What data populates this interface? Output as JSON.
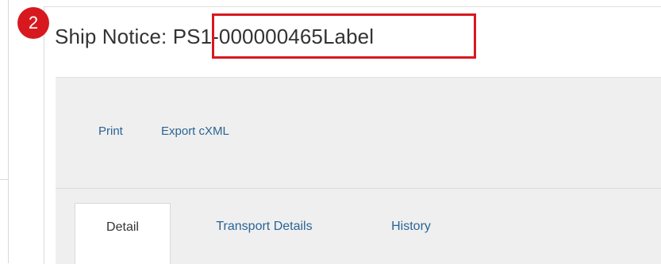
{
  "header": {
    "title_prefix": "Ship Notice: ",
    "title_id": "PS1-000000465Label",
    "step_badge": "2",
    "highlight_color": "#d7191f"
  },
  "toolbar": {
    "print_label": "Print",
    "export_label": "Export cXML"
  },
  "tabs": [
    {
      "label": "Detail",
      "active": true
    },
    {
      "label": "Transport Details",
      "active": false
    },
    {
      "label": "History",
      "active": false
    }
  ],
  "colors": {
    "link": "#2a6496",
    "toolbar_bg": "#efefef",
    "badge": "#d7191f"
  }
}
